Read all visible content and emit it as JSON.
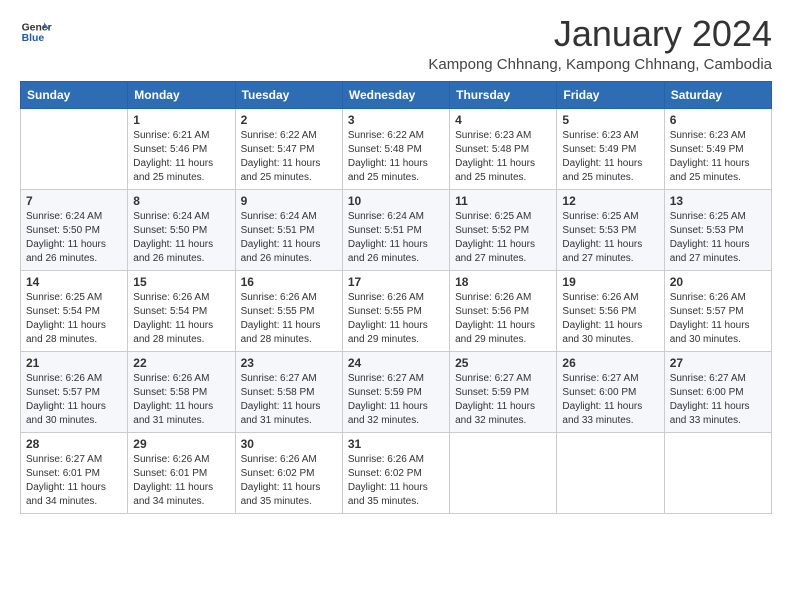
{
  "logo": {
    "line1": "General",
    "line2": "Blue"
  },
  "title": "January 2024",
  "subtitle": "Kampong Chhnang, Kampong Chhnang, Cambodia",
  "weekdays": [
    "Sunday",
    "Monday",
    "Tuesday",
    "Wednesday",
    "Thursday",
    "Friday",
    "Saturday"
  ],
  "weeks": [
    [
      {
        "day": "",
        "info": ""
      },
      {
        "day": "1",
        "info": "Sunrise: 6:21 AM\nSunset: 5:46 PM\nDaylight: 11 hours\nand 25 minutes."
      },
      {
        "day": "2",
        "info": "Sunrise: 6:22 AM\nSunset: 5:47 PM\nDaylight: 11 hours\nand 25 minutes."
      },
      {
        "day": "3",
        "info": "Sunrise: 6:22 AM\nSunset: 5:48 PM\nDaylight: 11 hours\nand 25 minutes."
      },
      {
        "day": "4",
        "info": "Sunrise: 6:23 AM\nSunset: 5:48 PM\nDaylight: 11 hours\nand 25 minutes."
      },
      {
        "day": "5",
        "info": "Sunrise: 6:23 AM\nSunset: 5:49 PM\nDaylight: 11 hours\nand 25 minutes."
      },
      {
        "day": "6",
        "info": "Sunrise: 6:23 AM\nSunset: 5:49 PM\nDaylight: 11 hours\nand 25 minutes."
      }
    ],
    [
      {
        "day": "7",
        "info": "Sunrise: 6:24 AM\nSunset: 5:50 PM\nDaylight: 11 hours\nand 26 minutes."
      },
      {
        "day": "8",
        "info": "Sunrise: 6:24 AM\nSunset: 5:50 PM\nDaylight: 11 hours\nand 26 minutes."
      },
      {
        "day": "9",
        "info": "Sunrise: 6:24 AM\nSunset: 5:51 PM\nDaylight: 11 hours\nand 26 minutes."
      },
      {
        "day": "10",
        "info": "Sunrise: 6:24 AM\nSunset: 5:51 PM\nDaylight: 11 hours\nand 26 minutes."
      },
      {
        "day": "11",
        "info": "Sunrise: 6:25 AM\nSunset: 5:52 PM\nDaylight: 11 hours\nand 27 minutes."
      },
      {
        "day": "12",
        "info": "Sunrise: 6:25 AM\nSunset: 5:53 PM\nDaylight: 11 hours\nand 27 minutes."
      },
      {
        "day": "13",
        "info": "Sunrise: 6:25 AM\nSunset: 5:53 PM\nDaylight: 11 hours\nand 27 minutes."
      }
    ],
    [
      {
        "day": "14",
        "info": "Sunrise: 6:25 AM\nSunset: 5:54 PM\nDaylight: 11 hours\nand 28 minutes."
      },
      {
        "day": "15",
        "info": "Sunrise: 6:26 AM\nSunset: 5:54 PM\nDaylight: 11 hours\nand 28 minutes."
      },
      {
        "day": "16",
        "info": "Sunrise: 6:26 AM\nSunset: 5:55 PM\nDaylight: 11 hours\nand 28 minutes."
      },
      {
        "day": "17",
        "info": "Sunrise: 6:26 AM\nSunset: 5:55 PM\nDaylight: 11 hours\nand 29 minutes."
      },
      {
        "day": "18",
        "info": "Sunrise: 6:26 AM\nSunset: 5:56 PM\nDaylight: 11 hours\nand 29 minutes."
      },
      {
        "day": "19",
        "info": "Sunrise: 6:26 AM\nSunset: 5:56 PM\nDaylight: 11 hours\nand 30 minutes."
      },
      {
        "day": "20",
        "info": "Sunrise: 6:26 AM\nSunset: 5:57 PM\nDaylight: 11 hours\nand 30 minutes."
      }
    ],
    [
      {
        "day": "21",
        "info": "Sunrise: 6:26 AM\nSunset: 5:57 PM\nDaylight: 11 hours\nand 30 minutes."
      },
      {
        "day": "22",
        "info": "Sunrise: 6:26 AM\nSunset: 5:58 PM\nDaylight: 11 hours\nand 31 minutes."
      },
      {
        "day": "23",
        "info": "Sunrise: 6:27 AM\nSunset: 5:58 PM\nDaylight: 11 hours\nand 31 minutes."
      },
      {
        "day": "24",
        "info": "Sunrise: 6:27 AM\nSunset: 5:59 PM\nDaylight: 11 hours\nand 32 minutes."
      },
      {
        "day": "25",
        "info": "Sunrise: 6:27 AM\nSunset: 5:59 PM\nDaylight: 11 hours\nand 32 minutes."
      },
      {
        "day": "26",
        "info": "Sunrise: 6:27 AM\nSunset: 6:00 PM\nDaylight: 11 hours\nand 33 minutes."
      },
      {
        "day": "27",
        "info": "Sunrise: 6:27 AM\nSunset: 6:00 PM\nDaylight: 11 hours\nand 33 minutes."
      }
    ],
    [
      {
        "day": "28",
        "info": "Sunrise: 6:27 AM\nSunset: 6:01 PM\nDaylight: 11 hours\nand 34 minutes."
      },
      {
        "day": "29",
        "info": "Sunrise: 6:26 AM\nSunset: 6:01 PM\nDaylight: 11 hours\nand 34 minutes."
      },
      {
        "day": "30",
        "info": "Sunrise: 6:26 AM\nSunset: 6:02 PM\nDaylight: 11 hours\nand 35 minutes."
      },
      {
        "day": "31",
        "info": "Sunrise: 6:26 AM\nSunset: 6:02 PM\nDaylight: 11 hours\nand 35 minutes."
      },
      {
        "day": "",
        "info": ""
      },
      {
        "day": "",
        "info": ""
      },
      {
        "day": "",
        "info": ""
      }
    ]
  ]
}
